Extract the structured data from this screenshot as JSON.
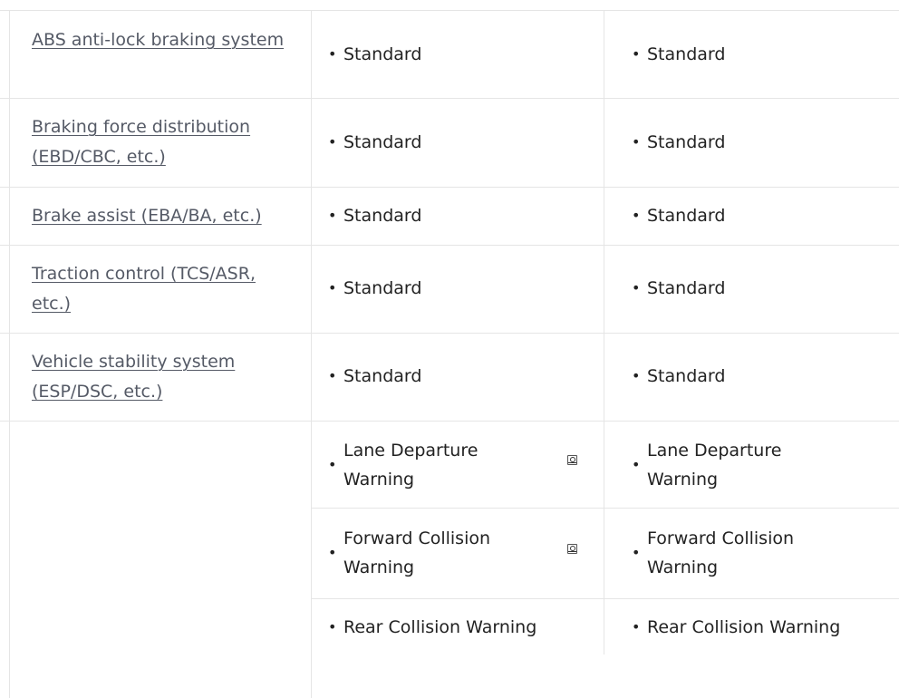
{
  "spec_table": {
    "rows": [
      {
        "label": "ABS anti-lock braking system",
        "col1": "Standard",
        "col2": "Standard"
      },
      {
        "label": "Braking force distribution (EBD/CBC, etc.)",
        "col1": "Standard",
        "col2": "Standard"
      },
      {
        "label": "Brake assist (EBA/BA, etc.)",
        "col1": "Standard",
        "col2": "Standard"
      },
      {
        "label": "Traction control (TCS/ASR, etc.)",
        "col1": "Standard",
        "col2": "Standard"
      },
      {
        "label": "Vehicle stability system (ESP/DSC, etc.)",
        "col1": "Standard",
        "col2": "Standard"
      }
    ],
    "warning_group": {
      "items": [
        {
          "col1": "Lane Departure Warning",
          "col2": "Lane Departure Warning",
          "icon": "magnifier-icon"
        },
        {
          "col1": "Forward Collision Warning",
          "col2": "Forward Collision Warning",
          "icon": "magnifier-icon"
        },
        {
          "col1": "Rear Collision Warning",
          "col2": "Rear Collision Warning"
        }
      ]
    },
    "bullet": "•"
  }
}
